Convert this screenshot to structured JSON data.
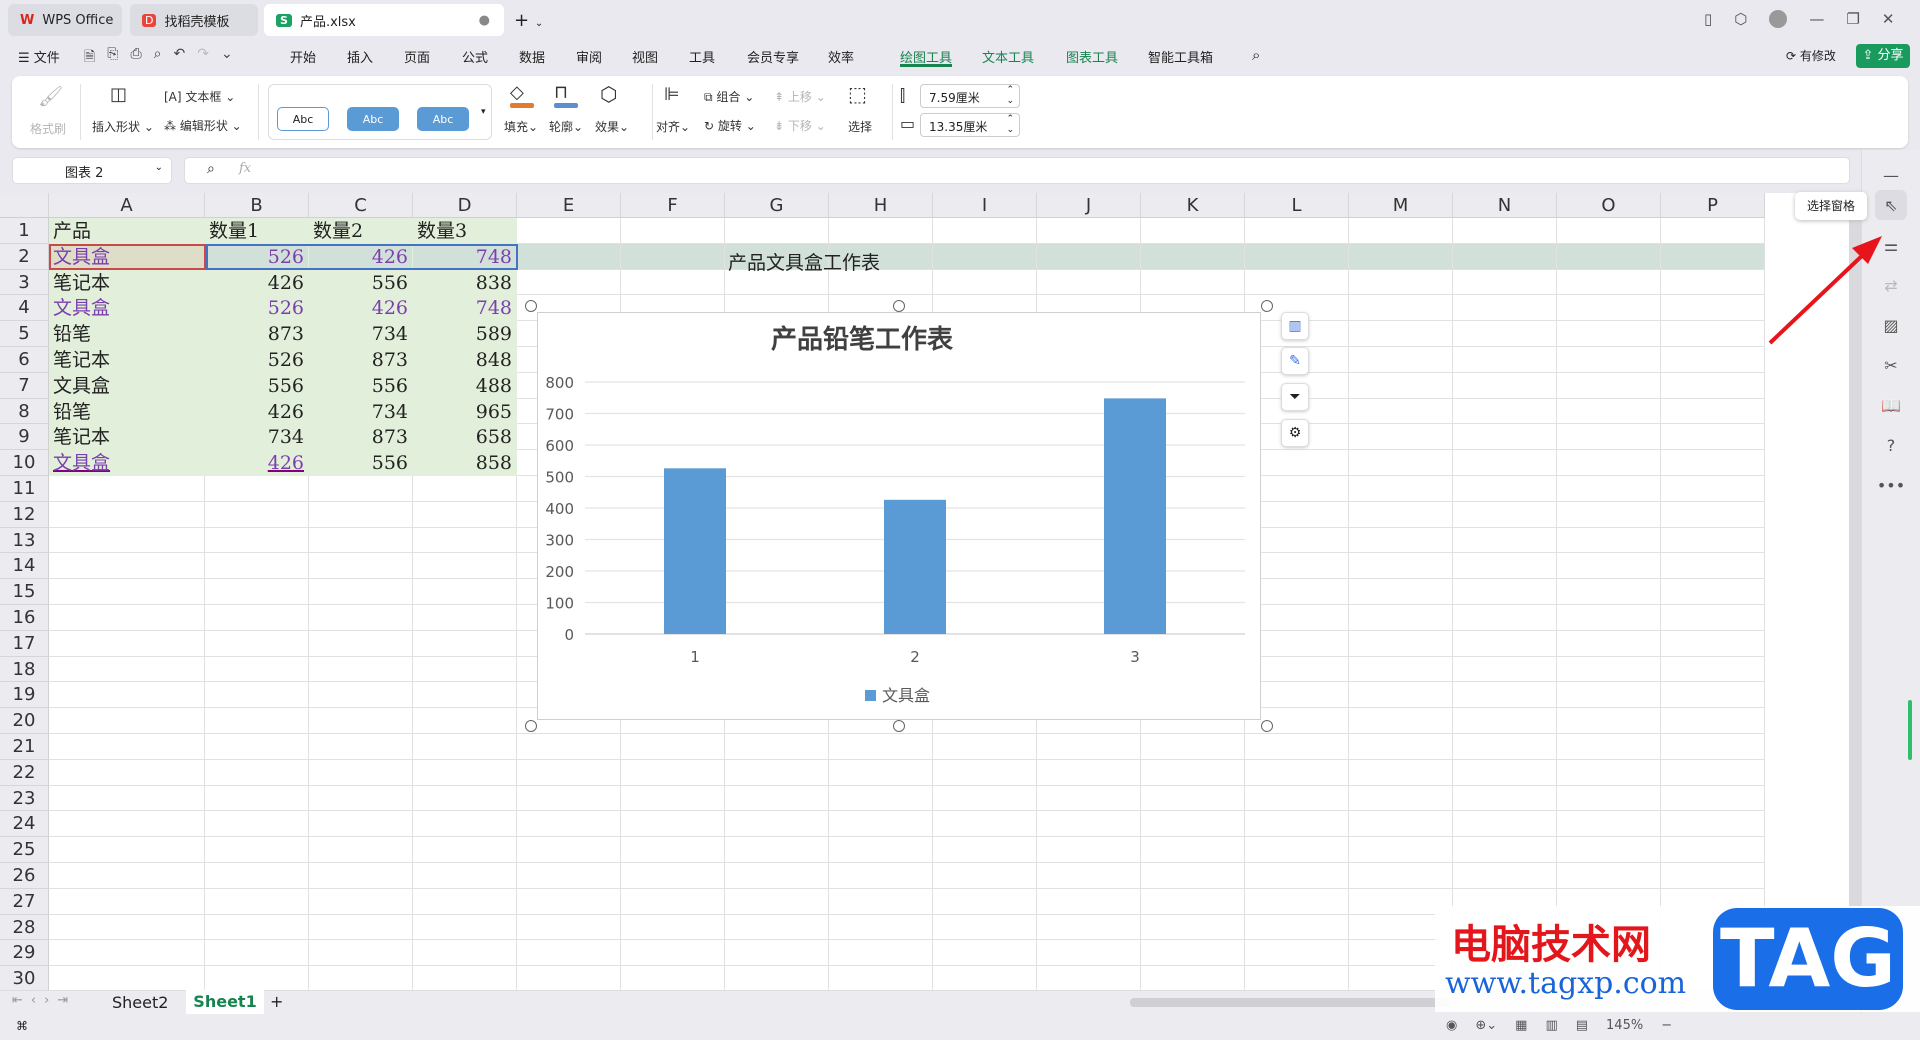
{
  "tabs": [
    {
      "label": "WPS Office"
    },
    {
      "label": "找稻壳模板"
    },
    {
      "label": "产品.xlsx"
    }
  ],
  "menu": {
    "file": "文件",
    "items": [
      "开始",
      "插入",
      "页面",
      "公式",
      "数据",
      "审阅",
      "视图",
      "工具",
      "会员专享",
      "效率"
    ],
    "context": [
      "绘图工具",
      "文本工具",
      "图表工具"
    ],
    "smart": "智能工具箱",
    "modified": "有修改",
    "share": "分享"
  },
  "ribbon": {
    "format_painter": "格式刷",
    "insert_shape": "插入形状",
    "textbox": "文本框",
    "edit_shape": "编辑形状",
    "abc": "Abc",
    "fill": "填充",
    "outline": "轮廓",
    "effect": "效果",
    "align": "对齐",
    "group": "组合",
    "rotate": "旋转",
    "up": "上移",
    "down": "下移",
    "select": "选择",
    "height": "7.59厘米",
    "width": "13.35厘米"
  },
  "formula": {
    "name_box": "图表 2",
    "fx": "fx",
    "value": ""
  },
  "sheet": {
    "columns": [
      "A",
      "B",
      "C",
      "D",
      "E",
      "F",
      "G",
      "H",
      "I",
      "J",
      "K",
      "L",
      "M",
      "N",
      "O",
      "P"
    ],
    "row_numbers": [
      1,
      2,
      3,
      4,
      5,
      6,
      7,
      8,
      9,
      10,
      11,
      12,
      13,
      14,
      15,
      16,
      17,
      18,
      19,
      20,
      21,
      22,
      23,
      24,
      25,
      26,
      27,
      28,
      29,
      30
    ],
    "rows": [
      [
        "产品",
        "数量1",
        "数量2",
        "数量3"
      ],
      [
        "文具盒",
        "526",
        "426",
        "748"
      ],
      [
        "笔记本",
        "426",
        "556",
        "838"
      ],
      [
        "文具盒",
        "526",
        "426",
        "748"
      ],
      [
        "铅笔",
        "873",
        "734",
        "589"
      ],
      [
        "笔记本",
        "526",
        "873",
        "848"
      ],
      [
        "文具盒",
        "556",
        "556",
        "488"
      ],
      [
        "铅笔",
        "426",
        "734",
        "965"
      ],
      [
        "笔记本",
        "734",
        "873",
        "658"
      ],
      [
        "文具盒",
        "426",
        "556",
        "858"
      ]
    ],
    "g2_text": "产品文具盒工作表"
  },
  "chart_data": {
    "type": "bar",
    "title": "产品铅笔工作表",
    "categories": [
      "1",
      "2",
      "3"
    ],
    "series": [
      {
        "name": "文具盒",
        "values": [
          526,
          426,
          748
        ]
      }
    ],
    "ylim": [
      0,
      800
    ],
    "yticks": [
      0,
      100,
      200,
      300,
      400,
      500,
      600,
      700,
      800
    ],
    "grid": true,
    "legend": "bottom",
    "color": "#5b9bd5"
  },
  "tooltip": "选择窗格",
  "sheet_tabs": [
    "Sheet2",
    "Sheet1"
  ],
  "status": {
    "zoom": "145%"
  },
  "watermark": {
    "site": "电脑技术网",
    "url": "www.tagxp.com",
    "logo": "TAG"
  },
  "colors": {
    "accent": "#17834f",
    "selection_fill": "#e2efda",
    "arrow": "#e8141b"
  }
}
